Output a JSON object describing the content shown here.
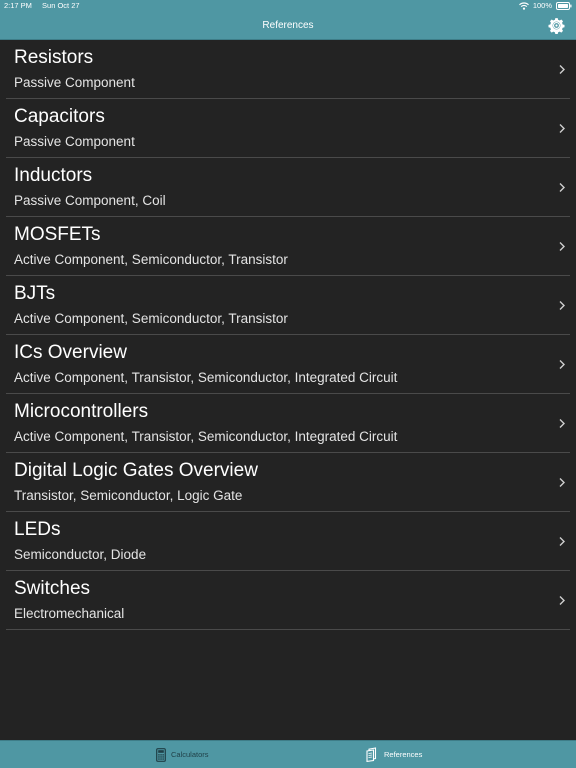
{
  "status_bar": {
    "time": "2:17 PM",
    "date": "Sun Oct 27",
    "battery": "100%",
    "icons": [
      "wifi-icon",
      "battery-icon"
    ]
  },
  "nav": {
    "title": "References",
    "settings_icon": "gear-icon"
  },
  "items": [
    {
      "title": "Resistors",
      "subtitle": "Passive Component"
    },
    {
      "title": "Capacitors",
      "subtitle": "Passive Component"
    },
    {
      "title": "Inductors",
      "subtitle": "Passive Component, Coil"
    },
    {
      "title": "MOSFETs",
      "subtitle": "Active Component, Semiconductor, Transistor"
    },
    {
      "title": "BJTs",
      "subtitle": "Active Component, Semiconductor, Transistor"
    },
    {
      "title": "ICs Overview",
      "subtitle": "Active Component, Transistor, Semiconductor, Integrated Circuit"
    },
    {
      "title": "Microcontrollers",
      "subtitle": "Active Component, Transistor, Semiconductor, Integrated Circuit"
    },
    {
      "title": "Digital Logic Gates Overview",
      "subtitle": "Transistor, Semiconductor, Logic Gate"
    },
    {
      "title": "LEDs",
      "subtitle": "Semiconductor, Diode"
    },
    {
      "title": "Switches",
      "subtitle": "Electromechanical"
    }
  ],
  "tabs": {
    "calculators": {
      "label": "Calculators",
      "icon": "calculator-icon"
    },
    "references": {
      "label": "References",
      "icon": "book-icon",
      "selected": true
    }
  },
  "colors": {
    "accent_bar": "#4f97a3",
    "background": "#232323",
    "separator": "#4a4a4a",
    "tab_inactive": "#1f3f46",
    "tab_active": "#ffffff"
  }
}
